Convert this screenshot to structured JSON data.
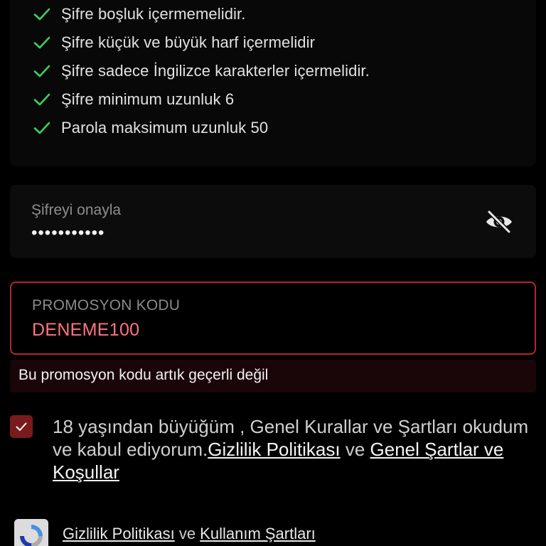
{
  "password_rules": [
    {
      "text": "Şifre boşluk içermemelidir.",
      "status": "passed"
    },
    {
      "text": "Şifre küçük ve büyük harf içermelidir",
      "status": "passed"
    },
    {
      "text": "Şifre sadece İngilizce karakterler içermelidir.",
      "status": "passed"
    },
    {
      "text": "Şifre minimum uzunluk 6",
      "status": "passed"
    },
    {
      "text": "Parola maksimum uzunluk 50",
      "status": "passed"
    }
  ],
  "confirm_password": {
    "label": "Şifreyi onayla",
    "value": "•••••••••••",
    "visibility_icon": "eye-off-icon"
  },
  "promo_code": {
    "label": "PROMOSYON KODU",
    "value": "DENEME100",
    "error": "Bu promosyon kodu artık geçerli değil"
  },
  "terms": {
    "checked": true,
    "text_before": "18 yaşından büyüğüm , Genel Kurallar ve Şartları okudum ve kabul ediyorum.",
    "privacy_link": "Gizlilik Politikası",
    "joiner": " ve ",
    "terms_link": "Genel Şartlar ve Koşullar"
  },
  "recaptcha_footer": {
    "privacy_link": "Gizlilik Politikası",
    "joiner": " ve ",
    "terms_link": "Kullanım Şartları"
  },
  "colors": {
    "background": "#000000",
    "check_green": "#3ecf5c",
    "error_red": "#b3262e",
    "promo_value_red": "#ff7480",
    "checkbox_bg": "#7a1a1c"
  }
}
